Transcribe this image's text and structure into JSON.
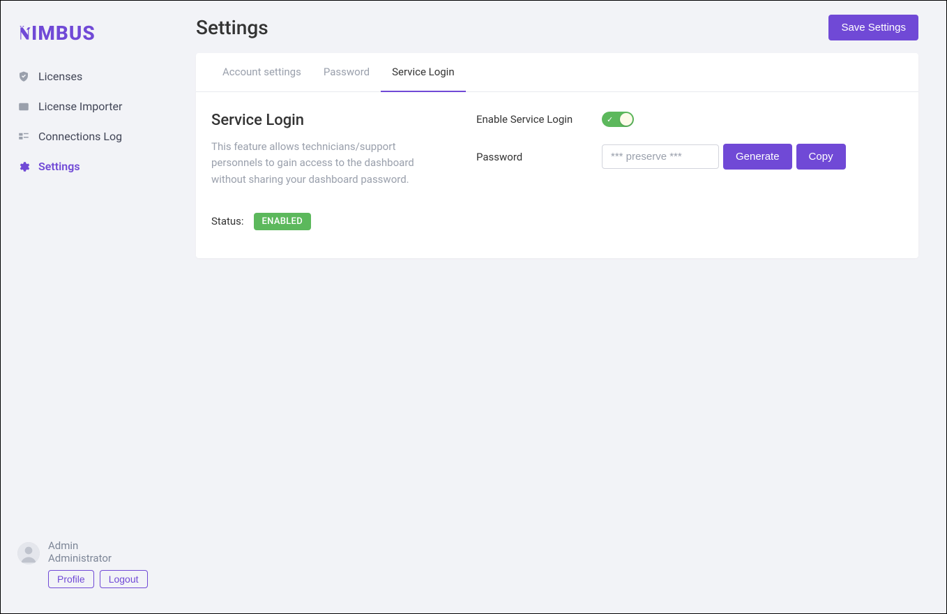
{
  "logo": "NIMBUS",
  "sidebar": {
    "items": [
      {
        "label": "Licenses"
      },
      {
        "label": "License Importer"
      },
      {
        "label": "Connections Log"
      },
      {
        "label": "Settings"
      }
    ]
  },
  "user": {
    "name": "Admin",
    "role": "Administrator",
    "profile_btn": "Profile",
    "logout_btn": "Logout"
  },
  "page": {
    "title": "Settings",
    "save_btn": "Save Settings"
  },
  "tabs": [
    {
      "label": "Account settings"
    },
    {
      "label": "Password"
    },
    {
      "label": "Service Login"
    }
  ],
  "service_login": {
    "title": "Service Login",
    "description": "This feature allows technicians/support personnels to gain access to the dashboard without sharing your dashboard password.",
    "status_label": "Status:",
    "status_value": "ENABLED",
    "enable_label": "Enable Service Login",
    "password_label": "Password",
    "password_placeholder": "*** preserve ***",
    "generate_btn": "Generate",
    "copy_btn": "Copy"
  }
}
